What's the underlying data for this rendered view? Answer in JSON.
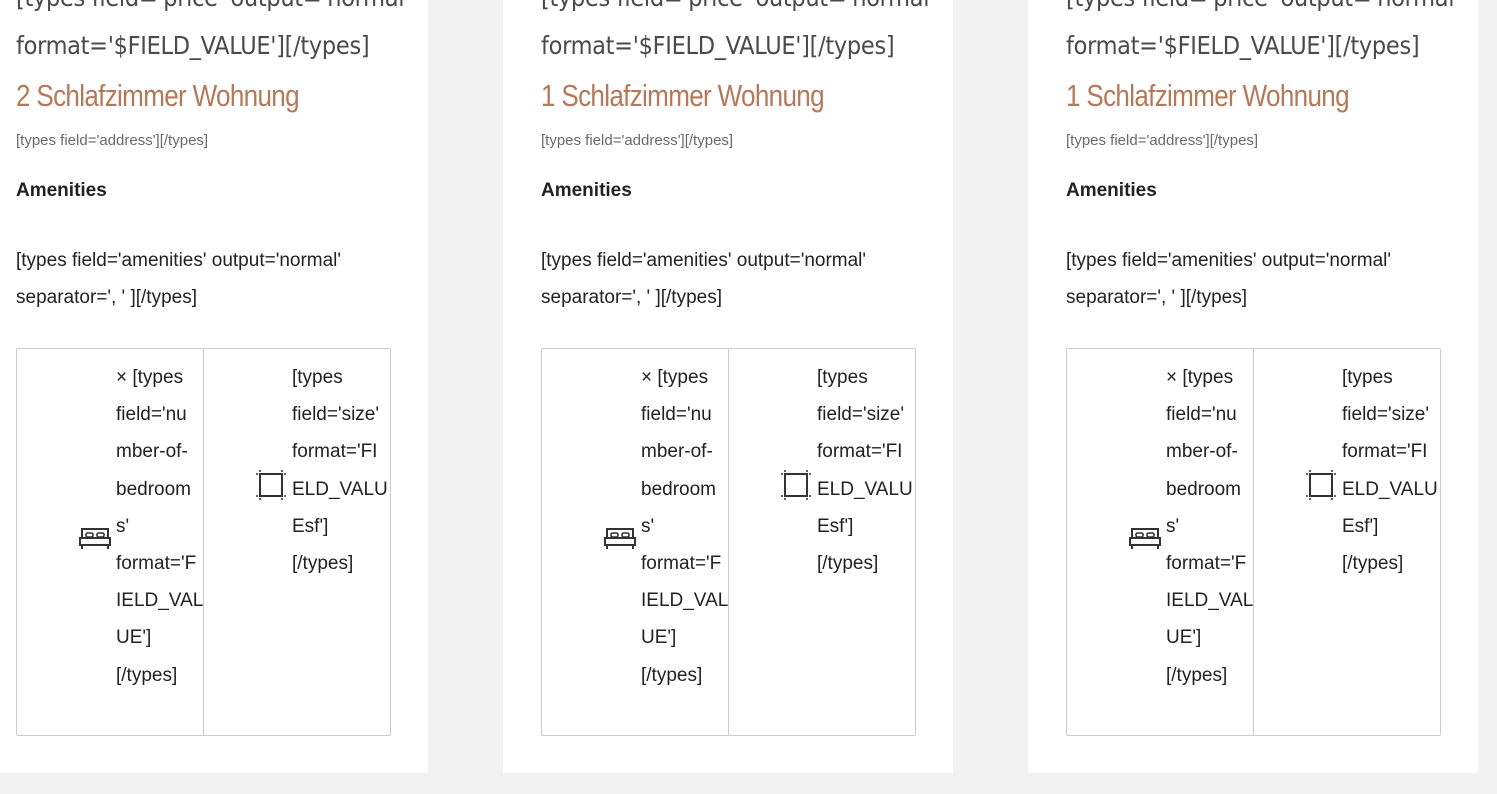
{
  "cards": [
    {
      "price_lines": [
        "[types field='price' output='normal'",
        "format='$FIELD_VALUE'][/types]"
      ],
      "title": "2 Schlafzimmer Wohnung",
      "address": "[types field='address'][/types]",
      "amenities_heading": "Amenities",
      "amenities_lines": [
        "[types field='amenities' output='normal'",
        "separator=', ' ][/types]"
      ],
      "bedroom_lines": [
        "× [types",
        "field='nu",
        "mber-of-",
        "bedroom",
        "s'",
        "format='F",
        "IELD_VAL",
        "UE']",
        "[/types]"
      ],
      "size_lines": [
        "[types",
        "field='size'",
        "format='FI",
        "ELD_VALU",
        "Esf']",
        "[/types]"
      ]
    },
    {
      "price_lines": [
        "[types field='price' output='normal'",
        "format='$FIELD_VALUE'][/types]"
      ],
      "title": "1 Schlafzimmer Wohnung",
      "address": "[types field='address'][/types]",
      "amenities_heading": "Amenities",
      "amenities_lines": [
        "[types field='amenities' output='normal'",
        "separator=', ' ][/types]"
      ],
      "bedroom_lines": [
        "× [types",
        "field='nu",
        "mber-of-",
        "bedroom",
        "s'",
        "format='F",
        "IELD_VAL",
        "UE']",
        "[/types]"
      ],
      "size_lines": [
        "[types",
        "field='size'",
        "format='FI",
        "ELD_VALU",
        "Esf']",
        "[/types]"
      ]
    },
    {
      "price_lines": [
        "[types field='price' output='normal'",
        "format='$FIELD_VALUE'][/types]"
      ],
      "title": "1 Schlafzimmer Wohnung",
      "address": "[types field='address'][/types]",
      "amenities_heading": "Amenities",
      "amenities_lines": [
        "[types field='amenities' output='normal'",
        "separator=', ' ][/types]"
      ],
      "bedroom_lines": [
        "× [types",
        "field='nu",
        "mber-of-",
        "bedroom",
        "s'",
        "format='F",
        "IELD_VAL",
        "UE']",
        "[/types]"
      ],
      "size_lines": [
        "[types",
        "field='size'",
        "format='FI",
        "ELD_VALU",
        "Esf']",
        "[/types]"
      ]
    }
  ],
  "icons": {
    "bedroom": "bed-icon",
    "size": "area-size-icon"
  },
  "colors": {
    "title_accent": "#b5795a",
    "page_background": "#f2f2f2",
    "card_background": "#ffffff"
  }
}
